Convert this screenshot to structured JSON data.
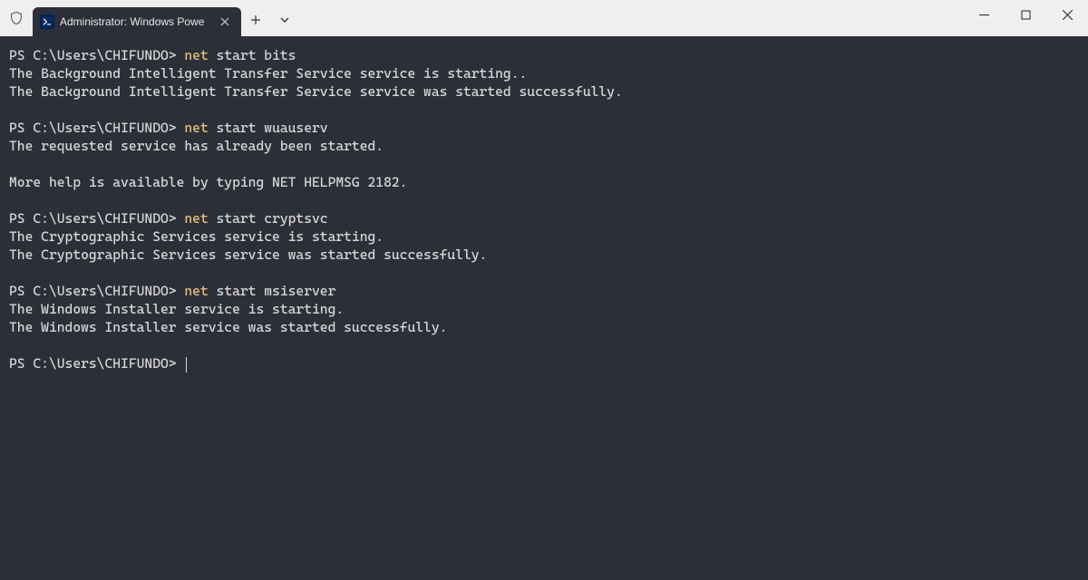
{
  "tab": {
    "title": "Administrator: Windows Powe",
    "icon_text": ">_"
  },
  "prompt": "PS C:\\Users\\CHIFUNDO>",
  "blocks": [
    {
      "cmd_yellow": "net",
      "cmd_rest": " start bits",
      "output": [
        "The Background Intelligent Transfer Service service is starting..",
        "The Background Intelligent Transfer Service service was started successfully."
      ]
    },
    {
      "cmd_yellow": "net",
      "cmd_rest": " start wuauserv",
      "output": [
        "The requested service has already been started.",
        "",
        "More help is available by typing NET HELPMSG 2182."
      ]
    },
    {
      "cmd_yellow": "net",
      "cmd_rest": " start cryptsvc",
      "output": [
        "The Cryptographic Services service is starting.",
        "The Cryptographic Services service was started successfully."
      ]
    },
    {
      "cmd_yellow": "net",
      "cmd_rest": " start msiserver",
      "output": [
        "The Windows Installer service is starting.",
        "The Windows Installer service was started successfully."
      ]
    }
  ]
}
